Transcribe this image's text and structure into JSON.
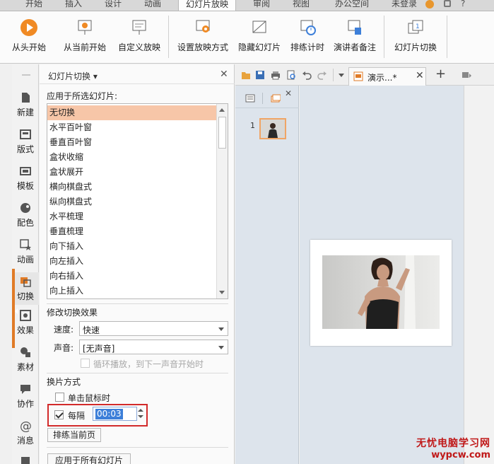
{
  "menu_tabs": [
    "开始",
    "插入",
    "设计",
    "动画",
    "幻灯片放映",
    "审阅",
    "视图",
    "办公空间",
    "未登录"
  ],
  "menu_active": "幻灯片放映",
  "ribbon": {
    "from_start": "从头开始",
    "from_current": "从当前开始",
    "custom_show": "自定义放映",
    "setup_show": "设置放映方式",
    "hide_slide": "隐藏幻灯片",
    "rehearse": "排练计时",
    "presenter_notes": "演讲者备注",
    "slide_transition": "幻灯片切换"
  },
  "left_nav": [
    "新建",
    "版式",
    "模板",
    "配色",
    "动画",
    "切换",
    "效果",
    "素材",
    "协作",
    "消息"
  ],
  "pane": {
    "title": "幻灯片切换",
    "apply_label": "应用于所选幻灯片:",
    "transitions": [
      "无切换",
      "水平百叶窗",
      "垂直百叶窗",
      "盒状收缩",
      "盒状展开",
      "横向棋盘式",
      "纵向棋盘式",
      "水平梳理",
      "垂直梳理",
      "向下插入",
      "向左插入",
      "向右插入",
      "向上插入"
    ],
    "selected_transition": "无切换",
    "modify_label": "修改切换效果",
    "speed_label": "速度:",
    "speed_value": "快速",
    "sound_label": "声音:",
    "sound_value": "[无声音]",
    "loop_label": "循环播放，到下一声音开始时",
    "advance_label": "换片方式",
    "on_click_label": "单击鼠标时",
    "every_label": "每隔",
    "every_value": "00:03",
    "rehearse_current": "排练当前页",
    "apply_all": "应用于所有幻灯片"
  },
  "doc": {
    "tab_title": "演示...*",
    "slide_number": "1"
  },
  "watermark": {
    "line1": "无忧电脑学习网",
    "line2": "wypcw.com"
  },
  "colors": {
    "accent": "#e07b27",
    "selection": "#f7c6a8",
    "highlight_box": "#d22a2a",
    "input_selection": "#3d7fd9"
  }
}
